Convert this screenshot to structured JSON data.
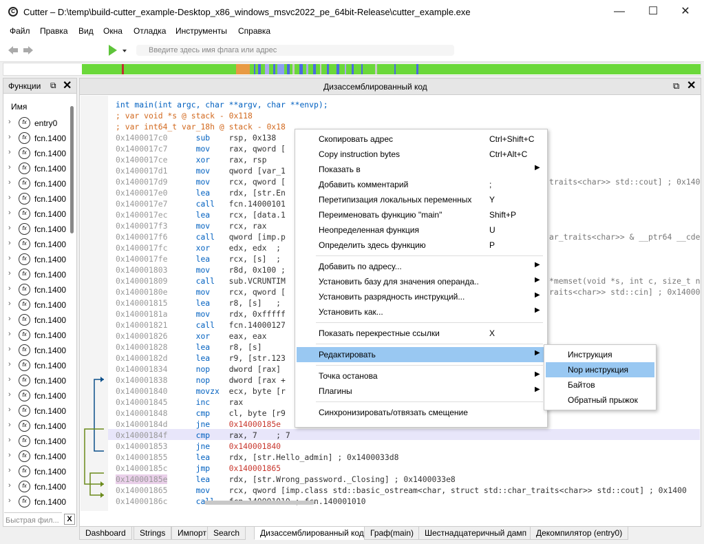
{
  "window": {
    "title": "Cutter – D:\\temp\\build-cutter_example-Desktop_x86_windows_msvc2022_pe_64bit-Release\\cutter_example.exe",
    "minimize": "—",
    "maximize": "☐",
    "close": "✕"
  },
  "menu": [
    "Файл",
    "Правка",
    "Вид",
    "Окна",
    "Отладка",
    "Инструменты",
    "Справка"
  ],
  "toolbar": {
    "search_placeholder": "Введите здесь имя флага или адрес"
  },
  "functions": {
    "title": "Функции",
    "column": "Имя",
    "filter_placeholder": "Быстрая фил...",
    "clear": "X",
    "items": [
      "entry0",
      "fcn.1400",
      "fcn.1400",
      "fcn.1400",
      "fcn.1400",
      "fcn.1400",
      "fcn.1400",
      "fcn.1400",
      "fcn.1400",
      "fcn.1400",
      "fcn.1400",
      "fcn.1400",
      "fcn.1400",
      "fcn.1400",
      "fcn.1400",
      "fcn.1400",
      "fcn.1400",
      "fcn.1400",
      "fcn.1400",
      "fcn.1400",
      "fcn.1400",
      "fcn.1400",
      "fcn.1400",
      "fcn.1400",
      "fcn.1400",
      "fcn.1400",
      "fcn.1400"
    ]
  },
  "disasm": {
    "title": "Дизассемблированный код",
    "header": [
      {
        "t": "int main(int argc, char **argv, char **envp);",
        "c": "k"
      },
      {
        "t": "; var void *s @ stack - 0x118",
        "c": "c"
      },
      {
        "t": "; var int64_t var_18h @ stack - 0x18",
        "c": "c"
      }
    ],
    "lines": [
      [
        "0x1400017c0",
        "sub",
        "rsp, 0x138",
        ""
      ],
      [
        "0x1400017c7",
        "mov",
        "rax, qword [",
        ""
      ],
      [
        "0x1400017ce",
        "xor",
        "rax, rsp",
        ""
      ],
      [
        "0x1400017d1",
        "mov",
        "qword [var_1",
        ""
      ],
      [
        "0x1400017d9",
        "mov",
        "rcx, qword [",
        "traits<char>> std::cout] ; 0x1400"
      ],
      [
        "0x1400017e0",
        "lea",
        "rdx, [str.En",
        ""
      ],
      [
        "0x1400017e7",
        "call",
        "fcn.14000101",
        ""
      ],
      [
        "0x1400017ec",
        "lea",
        "rcx, [data.1",
        ""
      ],
      [
        "0x1400017f3",
        "mov",
        "rcx, rax",
        ""
      ],
      [
        "0x1400017f6",
        "call",
        "qword [imp.p",
        "ar_traits<char>> & __ptr64 __cdec"
      ],
      [
        "0x1400017fc",
        "xor",
        "edx, edx  ;",
        ""
      ],
      [
        "0x1400017fe",
        "lea",
        "rcx, [s]  ;",
        ""
      ],
      [
        "0x140001803",
        "mov",
        "r8d, 0x100 ;",
        ""
      ],
      [
        "0x140001809",
        "call",
        "sub.VCRUNTIM",
        "*memset(void *s, int c, size_t n"
      ],
      [
        "0x14000180e",
        "mov",
        "rcx, qword [",
        "raits<char>> std::cin] ; 0x14000"
      ],
      [
        "0x140001815",
        "lea",
        "r8, [s]   ;",
        ""
      ],
      [
        "0x14000181a",
        "mov",
        "rdx, 0xfffff",
        ""
      ],
      [
        "0x140001821",
        "call",
        "fcn.14000127",
        ""
      ],
      [
        "0x140001826",
        "xor",
        "eax, eax",
        ""
      ],
      [
        "0x140001828",
        "lea",
        "r8, [s]",
        ""
      ],
      [
        "0x14000182d",
        "lea",
        "r9, [str.123",
        ""
      ],
      [
        "0x140001834",
        "nop",
        "dword [rax]",
        ""
      ],
      [
        "0x140001838",
        "nop",
        "dword [rax +",
        ""
      ],
      [
        "0x140001840",
        "movzx",
        "ecx, byte [r",
        ""
      ],
      [
        "0x140001845",
        "inc",
        "rax",
        ""
      ],
      [
        "0x140001848",
        "cmp",
        "cl, byte [r9",
        ""
      ],
      [
        "0x14000184d",
        "jne",
        "0x14000185e",
        ""
      ],
      [
        "0x14000184f",
        "cmp",
        "rax, 7    ; 7",
        ""
      ],
      [
        "0x140001853",
        "jne",
        "0x140001840",
        ""
      ],
      [
        "0x140001855",
        "lea",
        "rdx, [str.Hello_admin] ; 0x1400033d8",
        ""
      ],
      [
        "0x14000185c",
        "jmp",
        "0x140001865",
        ""
      ],
      [
        "0x14000185e",
        "lea",
        "rdx, [str.Wrong_password._Closing] ; 0x1400033e8",
        ""
      ],
      [
        "0x140001865",
        "mov",
        "rcx, qword [imp.class std::basic_ostream<char, struct std::char_traits<char>> std::cout] ; 0x1400",
        ""
      ],
      [
        "0x14000186c",
        "call",
        "fcn.140001010 ; fcn.140001010",
        ""
      ]
    ]
  },
  "context_menu": [
    {
      "label": "Скопировать адрес",
      "shortcut": "Ctrl+Shift+C"
    },
    {
      "label": "Copy instruction bytes",
      "shortcut": "Ctrl+Alt+C"
    },
    {
      "label": "Показать в",
      "shortcut": "",
      "sub": "▶"
    },
    {
      "label": "Добавить комментарий",
      "shortcut": ";"
    },
    {
      "label": "Перетипизация локальных переменных",
      "shortcut": "Y"
    },
    {
      "label": "Переименовать функцию \"main\"",
      "shortcut": "Shift+P"
    },
    {
      "label": "Неопределенная функция",
      "shortcut": "U"
    },
    {
      "label": "Определить здесь функцию",
      "shortcut": "P"
    },
    {
      "label": "Добавить по адресу...",
      "shortcut": "",
      "sub": "▶"
    },
    {
      "label": "Установить базу для значения операнда..",
      "shortcut": "",
      "sub": "▶"
    },
    {
      "label": "Установить разрядность инструкций...",
      "shortcut": "",
      "sub": "▶"
    },
    {
      "label": "Установить как...",
      "shortcut": "",
      "sub": "▶"
    },
    {
      "label": "Показать перекрестные ссылки",
      "shortcut": "X"
    },
    {
      "label": "Редактировать",
      "shortcut": "",
      "sub": "▶"
    },
    {
      "label": "Точка останова",
      "shortcut": "",
      "sub": "▶"
    },
    {
      "label": "Плагины",
      "shortcut": "",
      "sub": "▶"
    },
    {
      "label": "Синхронизировать/отвязать смещение",
      "shortcut": ""
    }
  ],
  "submenu": [
    "Инструкция",
    "Nop инструкция",
    "Байтов",
    "Обратный прыжок"
  ],
  "bottom_tabs": [
    "Dashboard",
    "Strings",
    "Импорт",
    "Search",
    "Дизассемблированный код",
    "Граф(main)",
    "Шестнадцатеричный дамп",
    "Декомпилятор (entry0)"
  ],
  "colors": {
    "highlight": "#99c8f2",
    "current_line": "#e8e6fa",
    "accent": "#0060c0"
  }
}
